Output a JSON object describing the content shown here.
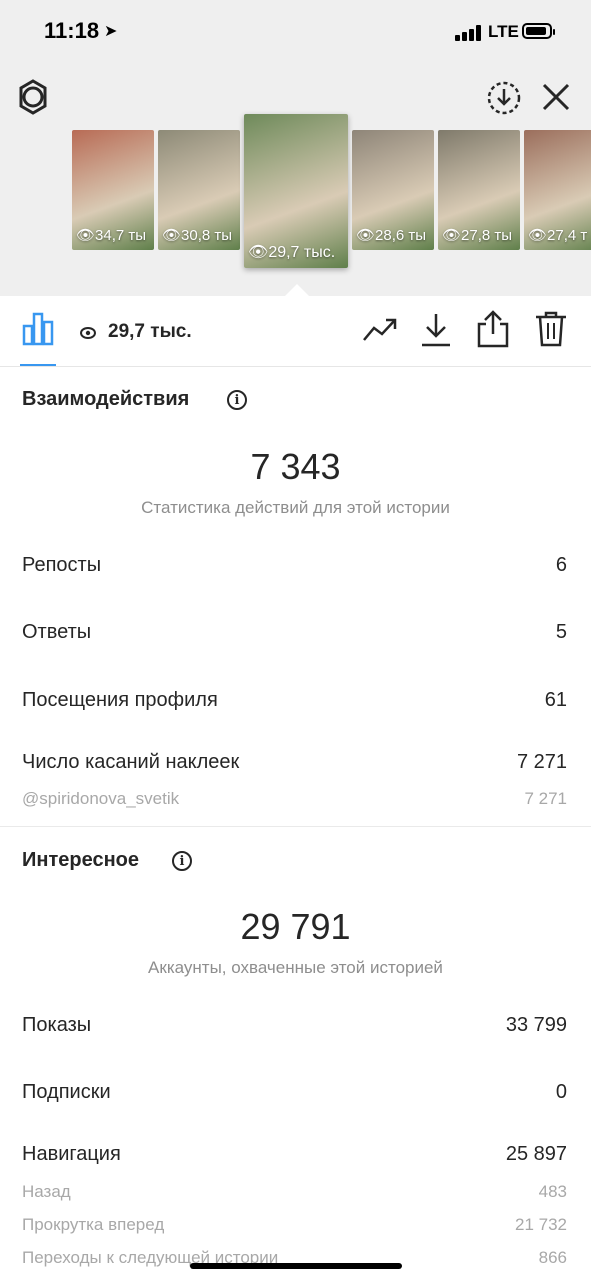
{
  "status_bar": {
    "time": "11:18",
    "network": "LTE"
  },
  "stories": [
    {
      "views": "34,7 ты",
      "color": "#b86b55"
    },
    {
      "views": "30,8 ты",
      "color": "#8d8a77"
    },
    {
      "views": "29,7 тыс.",
      "color": "#6e8a5a",
      "selected": true
    },
    {
      "views": "28,6 ты",
      "color": "#8e8578"
    },
    {
      "views": "27,8 ты",
      "color": "#7f7a6b"
    },
    {
      "views": "27,4 т",
      "color": "#9b6e5c"
    }
  ],
  "toolbar": {
    "views": "29,7 тыс."
  },
  "interactions": {
    "title": "Взаимодействия",
    "total": "7 343",
    "subtitle": "Статистика действий для этой истории",
    "rows": [
      {
        "label": "Репосты",
        "value": "6"
      },
      {
        "label": "Ответы",
        "value": "5"
      },
      {
        "label": "Посещения профиля",
        "value": "61"
      },
      {
        "label": "Число касаний наклеек",
        "value": "7 271"
      }
    ],
    "sticker_detail": {
      "label": "@spiridonova_svetik",
      "value": "7 271"
    }
  },
  "discovery": {
    "title": "Интересное",
    "total": "29 791",
    "subtitle": "Аккаунты, охваченные этой историей",
    "rows": [
      {
        "label": "Показы",
        "value": "33 799"
      },
      {
        "label": "Подписки",
        "value": "0"
      },
      {
        "label": "Навигация",
        "value": "25 897"
      }
    ],
    "navigation_details": [
      {
        "label": "Назад",
        "value": "483"
      },
      {
        "label": "Прокрутка вперед",
        "value": "21 732"
      },
      {
        "label": "Переходы к следующей истории",
        "value": "866"
      }
    ]
  },
  "colors": {
    "accent": "#3897f0"
  }
}
